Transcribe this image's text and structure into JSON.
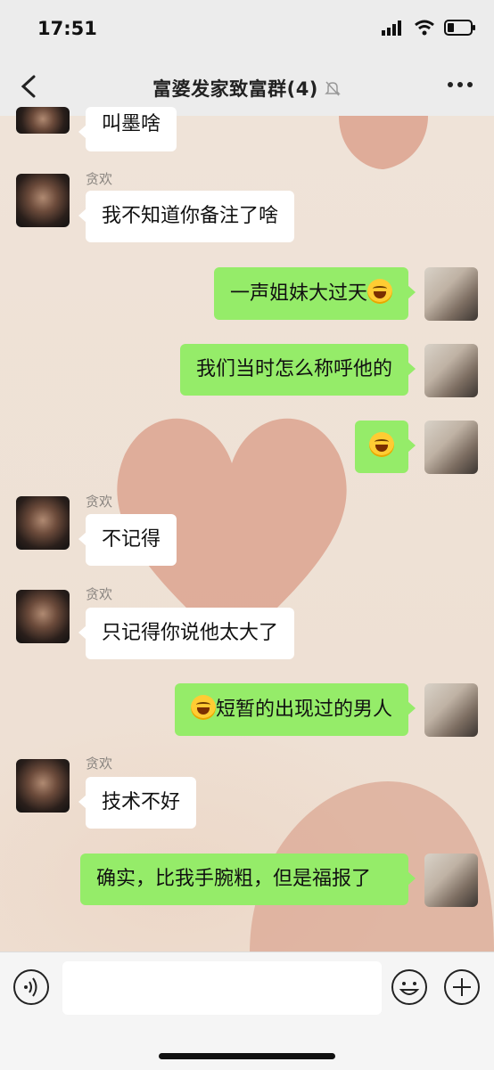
{
  "status": {
    "time": "17:51"
  },
  "header": {
    "title": "富婆发家致富群(4)"
  },
  "messages": [
    {
      "side": "left",
      "text": "叫墨啥"
    },
    {
      "side": "left",
      "sender": "贪欢",
      "text": "我不知道你备注了啥"
    },
    {
      "side": "right",
      "text": "一声姐妹大过天",
      "emoji": "tears-of-joy"
    },
    {
      "side": "right",
      "text": "我们当时怎么称呼他的"
    },
    {
      "side": "right",
      "emoji": "tears-of-joy"
    },
    {
      "side": "left",
      "sender": "贪欢",
      "text": "不记得"
    },
    {
      "side": "left",
      "sender": "贪欢",
      "text": "只记得你说他太大了"
    },
    {
      "side": "right",
      "text": "短暂的出现过的男人",
      "emoji": "loudly-crying"
    },
    {
      "side": "left",
      "sender": "贪欢",
      "text": "技术不好"
    },
    {
      "side": "right",
      "text": "确实，比我手腕粗，但是福报了"
    }
  ],
  "input": {
    "placeholder": ""
  },
  "colors": {
    "green_bubble": "#95ec69",
    "white_bubble": "#ffffff",
    "bar": "#ececec"
  }
}
